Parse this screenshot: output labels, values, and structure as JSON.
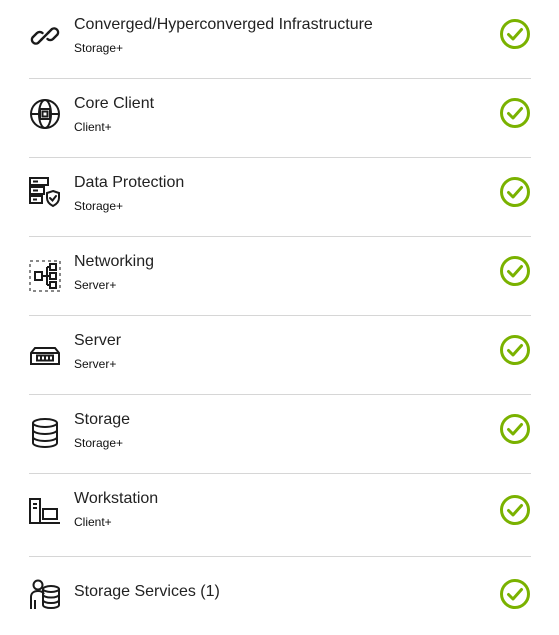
{
  "colors": {
    "check": "#7ab200",
    "icon": "#1a1a1a",
    "divider": "#d6d6d6"
  },
  "items": [
    {
      "title": "Converged/Hyperconverged Infrastructure",
      "subtitle": "Storage+",
      "icon": "link-chain-icon",
      "status_icon": "check-circle-icon"
    },
    {
      "title": "Core Client",
      "subtitle": "Client+",
      "icon": "globe-chip-icon",
      "status_icon": "check-circle-icon"
    },
    {
      "title": "Data Protection",
      "subtitle": "Storage+",
      "icon": "server-shield-icon",
      "status_icon": "check-circle-icon"
    },
    {
      "title": "Networking",
      "subtitle": "Server+",
      "icon": "network-tree-icon",
      "status_icon": "check-circle-icon"
    },
    {
      "title": "Server",
      "subtitle": "Server+",
      "icon": "server-box-icon",
      "status_icon": "check-circle-icon"
    },
    {
      "title": "Storage",
      "subtitle": "Storage+",
      "icon": "database-icon",
      "status_icon": "check-circle-icon"
    },
    {
      "title": "Workstation",
      "subtitle": "Client+",
      "icon": "workstation-icon",
      "status_icon": "check-circle-icon"
    },
    {
      "title": "Storage Services (1)",
      "icon": "user-database-icon",
      "status_icon": "check-circle-icon"
    }
  ]
}
